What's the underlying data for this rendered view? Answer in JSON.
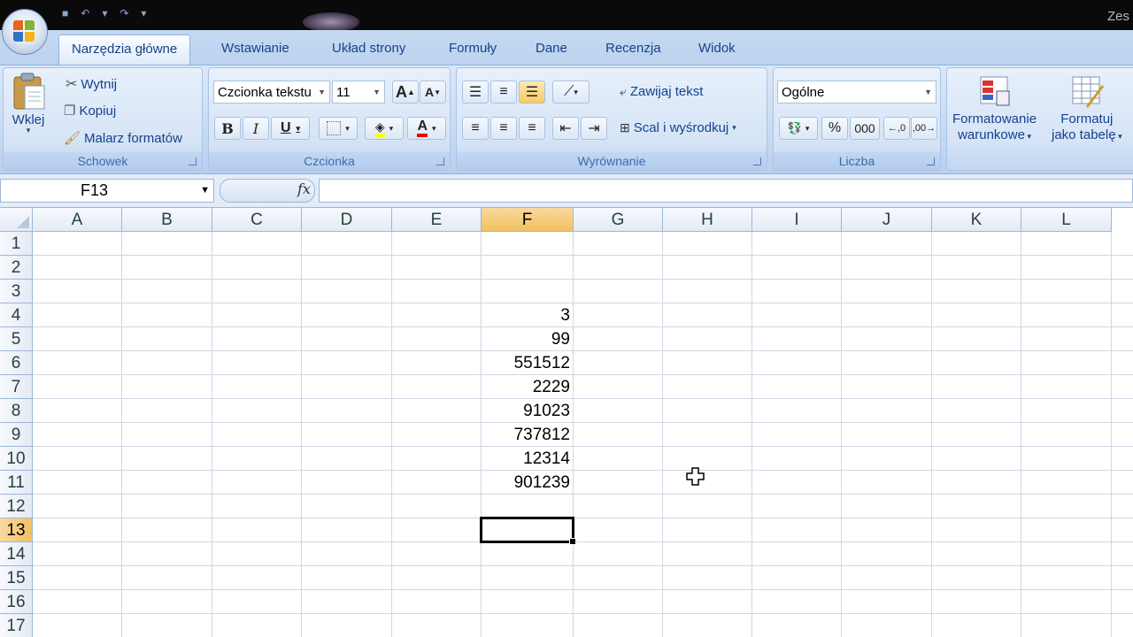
{
  "window": {
    "title_fragment": "Zes"
  },
  "tabs": [
    {
      "label": "Narzędzia główne",
      "active": true
    },
    {
      "label": "Wstawianie"
    },
    {
      "label": "Układ strony"
    },
    {
      "label": "Formuły"
    },
    {
      "label": "Dane"
    },
    {
      "label": "Recenzja"
    },
    {
      "label": "Widok"
    }
  ],
  "clipboard": {
    "group_label": "Schowek",
    "paste_label": "Wklej",
    "cut_label": "Wytnij",
    "copy_label": "Kopiuj",
    "format_painter_label": "Malarz formatów"
  },
  "font": {
    "group_label": "Czcionka",
    "font_name": "Czcionka tekstu",
    "font_size": "11",
    "bold": "B",
    "italic": "I",
    "underline": "U",
    "grow": "A",
    "shrink": "A"
  },
  "alignment": {
    "group_label": "Wyrównanie",
    "wrap_text_label": "Zawijaj tekst",
    "merge_center_label": "Scal i wyśrodkuj"
  },
  "number": {
    "group_label": "Liczba",
    "format": "Ogólne",
    "percent": "%",
    "thousands": "000"
  },
  "styles": {
    "conditional_line1": "Formatowanie",
    "conditional_line2": "warunkowe",
    "table_line1": "Formatuj",
    "table_line2": "jako tabelę"
  },
  "formula_bar": {
    "name_box": "F13",
    "fx_label": "fx",
    "formula": ""
  },
  "sheet": {
    "columns": [
      "A",
      "B",
      "C",
      "D",
      "E",
      "F",
      "G",
      "H",
      "I",
      "J",
      "K",
      "L"
    ],
    "rows": [
      "1",
      "2",
      "3",
      "4",
      "5",
      "6",
      "7",
      "8",
      "9",
      "10",
      "11",
      "12",
      "13",
      "14",
      "15",
      "16",
      "17"
    ],
    "active_cell": "F13",
    "values": {
      "F4": "3",
      "F5": "99",
      "F6": "551512",
      "F7": "2229",
      "F8": "91023",
      "F9": "737812",
      "F10": "12314",
      "F11": "901239"
    }
  },
  "colors": {
    "selection_header": "#f1c15f",
    "ribbon": "#c7dbf3",
    "grid_line": "#d0d7e5"
  }
}
